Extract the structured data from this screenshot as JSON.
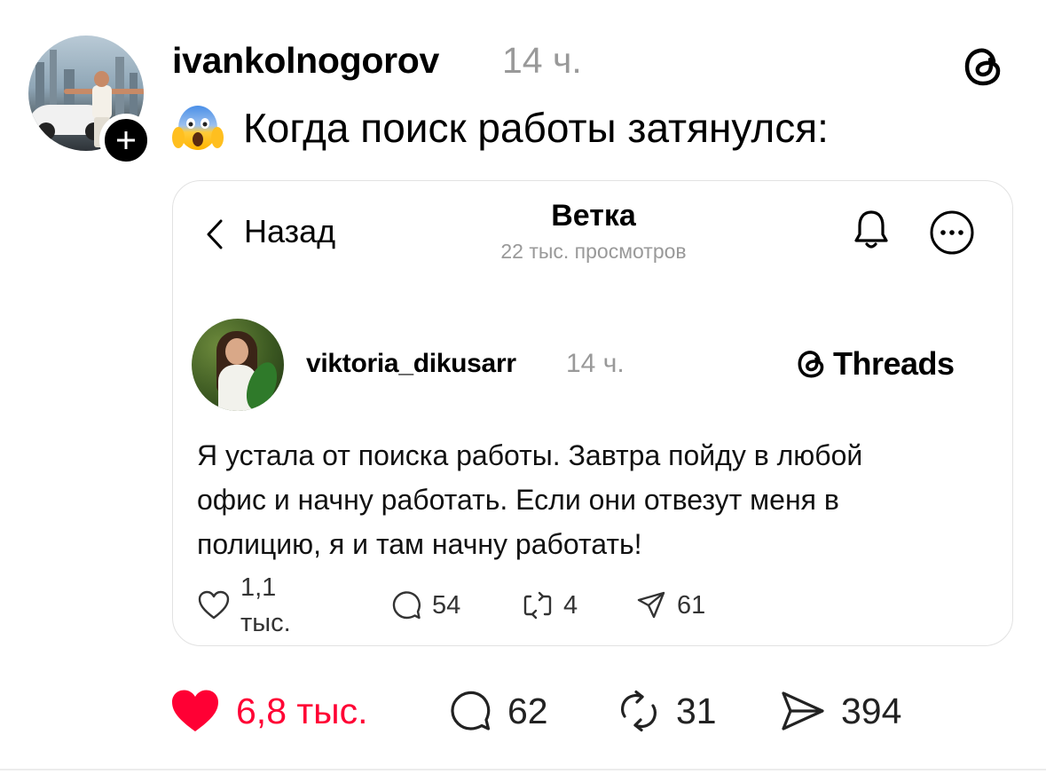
{
  "post": {
    "username": "ivankolnogorov",
    "time": "14 ч.",
    "caption": "Когда поиск работы затянулся:",
    "caption_emoji": "scream-emoji",
    "icons": {
      "platform": "threads-logo-icon",
      "follow": "plus-icon"
    }
  },
  "embedded": {
    "nav": {
      "back_label": "Назад",
      "title": "Ветка",
      "views": "22 тыс. просмотров",
      "icons": [
        "chevron-left-icon",
        "bell-icon",
        "more-icon"
      ]
    },
    "author": {
      "username": "viktoria_dikusarr",
      "time": "14 ч.",
      "brand": "Threads"
    },
    "text_lines": [
      "Я устала от поиска работы. Завтра пойду в любой",
      "офис и начну работать. Если они отвезут меня в",
      "полицию, я и там начну работать!"
    ],
    "actions": {
      "likes": "1,1 тыс.",
      "comments": "54",
      "reposts": "4",
      "shares": "61"
    }
  },
  "actions": {
    "likes": "6,8 тыс.",
    "comments": "62",
    "reposts": "31",
    "shares": "394"
  },
  "colors": {
    "like_active": "#ff0034",
    "muted_text": "#999999",
    "border": "#e2e2e2"
  }
}
